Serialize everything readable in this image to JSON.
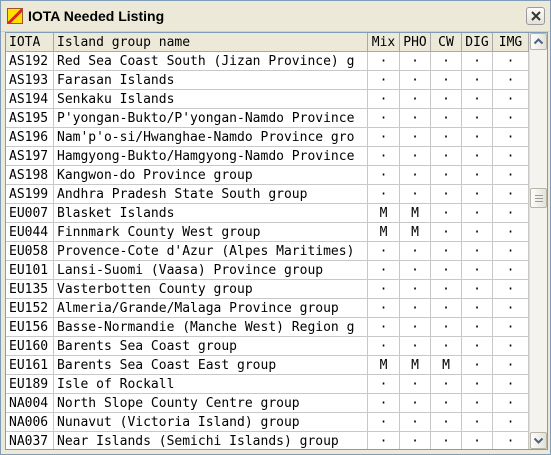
{
  "window": {
    "title": "IOTA Needed Listing"
  },
  "icons": {
    "app": "app-logo-icon",
    "close": "close-icon",
    "scroll_up": "scroll-up-arrow-icon",
    "scroll_down": "scroll-down-arrow-icon"
  },
  "table": {
    "columns": [
      "IOTA",
      "Island group name",
      "Mix",
      "PHO",
      "CW",
      "DIG",
      "IMG"
    ],
    "rows": [
      {
        "iota": "AS192",
        "name": "Red Sea Coast South (Jizan Province) g",
        "mix": "·",
        "pho": "·",
        "cw": "·",
        "dig": "·",
        "img": "·"
      },
      {
        "iota": "AS193",
        "name": "Farasan Islands",
        "mix": "·",
        "pho": "·",
        "cw": "·",
        "dig": "·",
        "img": "·"
      },
      {
        "iota": "AS194",
        "name": "Senkaku Islands",
        "mix": "·",
        "pho": "·",
        "cw": "·",
        "dig": "·",
        "img": "·"
      },
      {
        "iota": "AS195",
        "name": "P'yongan-Bukto/P'yongan-Namdo Province",
        "mix": "·",
        "pho": "·",
        "cw": "·",
        "dig": "·",
        "img": "·"
      },
      {
        "iota": "AS196",
        "name": "Nam'p'o-si/Hwanghae-Namdo Province gro",
        "mix": "·",
        "pho": "·",
        "cw": "·",
        "dig": "·",
        "img": "·"
      },
      {
        "iota": "AS197",
        "name": "Hamgyong-Bukto/Hamgyong-Namdo Province",
        "mix": "·",
        "pho": "·",
        "cw": "·",
        "dig": "·",
        "img": "·"
      },
      {
        "iota": "AS198",
        "name": "Kangwon-do Province group",
        "mix": "·",
        "pho": "·",
        "cw": "·",
        "dig": "·",
        "img": "·"
      },
      {
        "iota": "AS199",
        "name": "Andhra Pradesh State South group",
        "mix": "·",
        "pho": "·",
        "cw": "·",
        "dig": "·",
        "img": "·"
      },
      {
        "iota": "EU007",
        "name": "Blasket Islands",
        "mix": "M",
        "pho": "M",
        "cw": "·",
        "dig": "·",
        "img": "·"
      },
      {
        "iota": "EU044",
        "name": "Finnmark County West group",
        "mix": "M",
        "pho": "M",
        "cw": "·",
        "dig": "·",
        "img": "·"
      },
      {
        "iota": "EU058",
        "name": "Provence-Cote d'Azur (Alpes Maritimes)",
        "mix": "·",
        "pho": "·",
        "cw": "·",
        "dig": "·",
        "img": "·"
      },
      {
        "iota": "EU101",
        "name": "Lansi-Suomi (Vaasa) Province group",
        "mix": "·",
        "pho": "·",
        "cw": "·",
        "dig": "·",
        "img": "·"
      },
      {
        "iota": "EU135",
        "name": "Vasterbotten County group",
        "mix": "·",
        "pho": "·",
        "cw": "·",
        "dig": "·",
        "img": "·"
      },
      {
        "iota": "EU152",
        "name": "Almeria/Grande/Malaga Province group",
        "mix": "·",
        "pho": "·",
        "cw": "·",
        "dig": "·",
        "img": "·"
      },
      {
        "iota": "EU156",
        "name": "Basse-Normandie (Manche West) Region g",
        "mix": "·",
        "pho": "·",
        "cw": "·",
        "dig": "·",
        "img": "·"
      },
      {
        "iota": "EU160",
        "name": "Barents Sea Coast group",
        "mix": "·",
        "pho": "·",
        "cw": "·",
        "dig": "·",
        "img": "·"
      },
      {
        "iota": "EU161",
        "name": "Barents Sea Coast East group",
        "mix": "M",
        "pho": "M",
        "cw": "M",
        "dig": "·",
        "img": "·"
      },
      {
        "iota": "EU189",
        "name": "Isle of Rockall",
        "mix": "·",
        "pho": "·",
        "cw": "·",
        "dig": "·",
        "img": "·"
      },
      {
        "iota": "NA004",
        "name": "North Slope County Centre group",
        "mix": "·",
        "pho": "·",
        "cw": "·",
        "dig": "·",
        "img": "·"
      },
      {
        "iota": "NA006",
        "name": "Nunavut (Victoria Island) group",
        "mix": "·",
        "pho": "·",
        "cw": "·",
        "dig": "·",
        "img": "·"
      },
      {
        "iota": "NA037",
        "name": "Near Islands (Semichi Islands) group",
        "mix": "·",
        "pho": "·",
        "cw": "·",
        "dig": "·",
        "img": "·"
      }
    ]
  }
}
